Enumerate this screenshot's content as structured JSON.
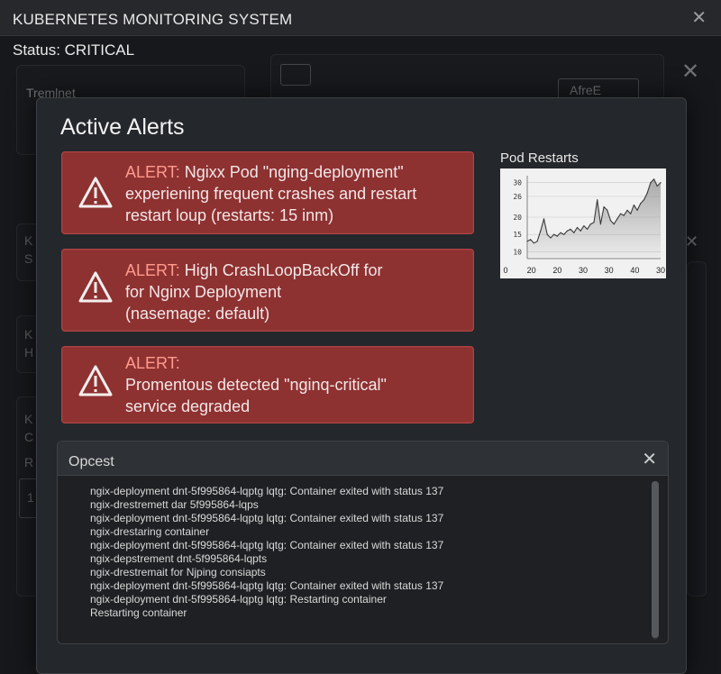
{
  "window": {
    "title": "KUBERNETES MONITORING SYSTEM",
    "close": "✕",
    "status": "Status: CRITICAL"
  },
  "background": {
    "panel_a_title": "Tremlnet",
    "panel_b_button": "AfreE",
    "panel_c_text_a": "K",
    "panel_c_text_b": "S",
    "panel_d_text_a": "K",
    "panel_d_text_b": "H",
    "panel_e_text_a": "K",
    "panel_e_text_b": "C",
    "panel_e_text_c": "R",
    "panel_e_text_d": "1",
    "close_a": "✕",
    "close_b": "✕"
  },
  "modal": {
    "title": "Active Alerts",
    "alerts": [
      {
        "label": "ALERT:",
        "line1": "Ngixx Pod \"nging-deployment\"",
        "line2": "experiening frequent crashes and restart",
        "line3": "restart loup (restarts: 15 inm)"
      },
      {
        "label": "ALERT:",
        "line1": "High CrashLoopBackOff for",
        "line2": "for Nginx Deployment",
        "line3": "(nasemage: default)"
      },
      {
        "label": "ALERT:",
        "line1": "Promentous detected \"nginq-critical\"",
        "line2": "service degraded",
        "line3": ""
      }
    ],
    "warning_icon": "warning-triangle-icon",
    "alert_color": "#8e3131"
  },
  "chart_data": {
    "type": "line",
    "title": "Pod Restarts",
    "x_tick_labels": [
      "0",
      "20",
      "20",
      "30",
      "30",
      "40",
      "30"
    ],
    "y_tick_labels": [
      "30",
      "26",
      "20",
      "15",
      "10"
    ],
    "x": [
      0,
      1,
      2,
      3,
      4,
      5,
      6,
      7,
      8,
      9,
      10,
      11,
      12,
      13,
      14,
      15,
      16,
      17,
      18,
      19,
      20,
      21,
      22,
      23,
      24,
      25,
      26,
      27,
      28,
      29,
      30,
      31,
      32,
      33,
      34,
      35,
      36,
      37,
      38,
      39,
      40
    ],
    "values": [
      13,
      13.5,
      12.5,
      13,
      16,
      19.5,
      15,
      14,
      15,
      14.5,
      15.5,
      15,
      16,
      16.5,
      15.5,
      17,
      16,
      17.5,
      16.5,
      18,
      18.5,
      25,
      18,
      23,
      22,
      19,
      18,
      19.5,
      21,
      20.5,
      22,
      21,
      23.5,
      22,
      24,
      25,
      27,
      30,
      31,
      29,
      30
    ],
    "ylim": [
      8,
      32
    ],
    "grid": true,
    "line_color": "#3a3a3a",
    "fill_color": "#8c8c8c"
  },
  "output": {
    "title": "Opcest",
    "close": "✕",
    "lines": [
      "ngix-deployment dnt-5f995864-lqptg lqtg: Container exited with status 137",
      "ngix-drestremett dar 5f995864-lqps",
      "ngix-deployment dnt-5f995864-lqptg lqtg: Container exited with status 137",
      "ngix-drestaring container",
      "ngix-deployment dnt-5f995864-lqptg lqtg: Container exited with status 137",
      "ngix-depstrement dnt-5f995864-lqpts",
      "ngix-drestremait for Njping consiapts",
      "ngix-deployment dnt-5f995864-lqptg lqtg: Container exited with status 137",
      "ngix-deployment dnt-5f995864-lqptg lqtg: Restarting container",
      "Restarting container"
    ]
  }
}
